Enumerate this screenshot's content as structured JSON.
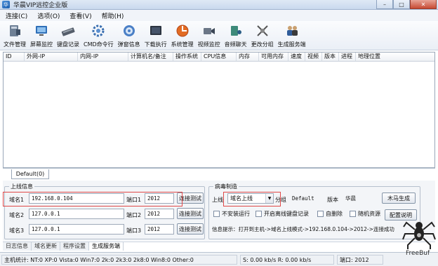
{
  "window": {
    "title": "华晨VIP远控企业版",
    "icon": "app-icon"
  },
  "menu": [
    "连接(C)",
    "选项(O)",
    "查看(V)",
    "帮助(H)"
  ],
  "toolbar": [
    {
      "label": "文件管理",
      "icon": "file-manager-icon"
    },
    {
      "label": "屏幕监控",
      "icon": "screen-monitor-icon"
    },
    {
      "label": "键盘记录",
      "icon": "keyboard-icon"
    },
    {
      "label": "CMD命令行",
      "icon": "cmd-icon"
    },
    {
      "label": "弹窗信息",
      "icon": "popup-icon"
    },
    {
      "label": "下载执行",
      "icon": "download-icon"
    },
    {
      "label": "系统管理",
      "icon": "system-icon"
    },
    {
      "label": "视频监控",
      "icon": "video-icon"
    },
    {
      "label": "音频聊天",
      "icon": "audio-icon"
    },
    {
      "label": "更改分组",
      "icon": "group-icon"
    },
    {
      "label": "生成服务端",
      "icon": "build-server-icon"
    }
  ],
  "hostlist": {
    "columns": [
      "ID",
      "外网-IP",
      "内网-IP",
      "计算机名/备注",
      "操作系统",
      "CPU信息",
      "内存",
      "可用内存",
      "速度",
      "视频",
      "版本",
      "进程",
      "地理位置"
    ]
  },
  "group_tab": "Default(0)",
  "online": {
    "legend": "上线信息",
    "rows": [
      {
        "label": "域名1",
        "host": "192.168.0.104",
        "port_label": "端口1",
        "port": "2012",
        "test": "连接测试"
      },
      {
        "label": "域名2",
        "host": "127.0.0.1",
        "port_label": "端口2",
        "port": "2012",
        "test": "连接测试"
      },
      {
        "label": "域名3",
        "host": "127.0.0.1",
        "port_label": "端口3",
        "port": "2012",
        "test": "连接测试"
      }
    ]
  },
  "virus": {
    "legend": "病毒制造",
    "online_label": "上线",
    "online_mode": "域名上线",
    "group_label": "分组",
    "group_value": "Default",
    "version_label": "版本",
    "version_value": "华晨",
    "build_button": "木马生成",
    "checks": [
      "不安装运行",
      "开启离线键盘记录",
      "自删除",
      "随机资源"
    ],
    "config_button": "配置说明",
    "info": "信息提示：打开到主机->域名上线模式->192.168.0.104->2012->连接成功"
  },
  "log_tabs": [
    "日志信息",
    "域名更新",
    "程序设置",
    "生成服务端"
  ],
  "status": {
    "stats": "主机统计: NT:0 XP:0 Vista:0 Win7:0 2k:0 2k3:0 2k8:0 Win8:0 Other:0",
    "speed": "S: 0.00 kb/s R: 0.00 kb/s",
    "port": "端口: 2012"
  },
  "watermark": "FreeBuf"
}
